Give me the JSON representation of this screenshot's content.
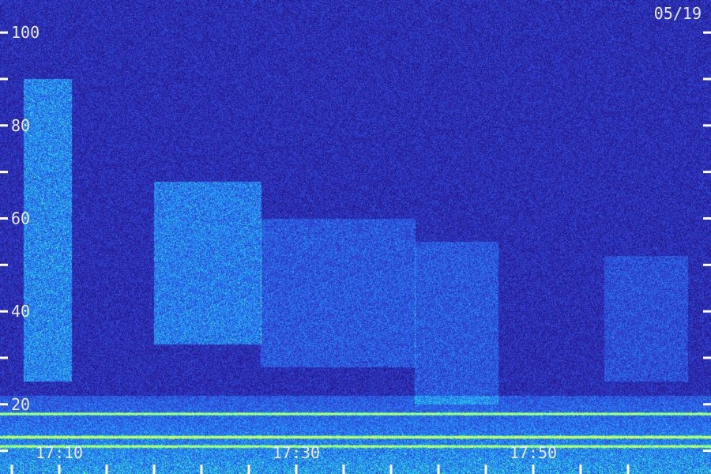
{
  "date_label": "05/19",
  "chart_data": {
    "type": "heatmap",
    "title": "",
    "xlabel": "",
    "ylabel": "",
    "y_ticks": [
      {
        "value": 100,
        "label": "100"
      },
      {
        "value": 90,
        "label": ""
      },
      {
        "value": 80,
        "label": "80"
      },
      {
        "value": 70,
        "label": ""
      },
      {
        "value": 60,
        "label": "60"
      },
      {
        "value": 50,
        "label": ""
      },
      {
        "value": 40,
        "label": "40"
      },
      {
        "value": 30,
        "label": ""
      },
      {
        "value": 20,
        "label": "20"
      },
      {
        "value": 10,
        "label": ""
      }
    ],
    "ylim": [
      5,
      107
    ],
    "x_start": "17:05",
    "x_end": "18:05",
    "x_ticks": [
      {
        "value": "17:06",
        "label": ""
      },
      {
        "value": "17:10",
        "label": "17:10"
      },
      {
        "value": "17:14",
        "label": ""
      },
      {
        "value": "17:18",
        "label": ""
      },
      {
        "value": "17:22",
        "label": ""
      },
      {
        "value": "17:26",
        "label": ""
      },
      {
        "value": "17:30",
        "label": "17:30"
      },
      {
        "value": "17:34",
        "label": ""
      },
      {
        "value": "17:38",
        "label": ""
      },
      {
        "value": "17:42",
        "label": ""
      },
      {
        "value": "17:46",
        "label": ""
      },
      {
        "value": "17:50",
        "label": "17:50"
      },
      {
        "value": "17:54",
        "label": ""
      },
      {
        "value": "17:58",
        "label": ""
      }
    ],
    "colormap": [
      "#140a4a",
      "#2a1fa0",
      "#3050e0",
      "#20a0ff",
      "#40ffb0",
      "#e0ff40"
    ],
    "features": [
      {
        "name": "broadband-burst-1",
        "t_start": "17:07",
        "t_end": "17:11",
        "f_low": 25,
        "f_high": 90,
        "intensity": 0.55
      },
      {
        "name": "harmonic-burst-2",
        "t_start": "17:18",
        "t_end": "17:27",
        "f_low": 33,
        "f_high": 68,
        "intensity": 0.5
      },
      {
        "name": "band-3",
        "t_start": "17:27",
        "t_end": "17:40",
        "f_low": 28,
        "f_high": 60,
        "intensity": 0.3
      },
      {
        "name": "band-4",
        "t_start": "17:40",
        "t_end": "17:47",
        "f_low": 20,
        "f_high": 55,
        "intensity": 0.3
      },
      {
        "name": "band-5",
        "t_start": "17:56",
        "t_end": "18:03",
        "f_low": 25,
        "f_high": 52,
        "intensity": 0.25
      },
      {
        "name": "low-freq-line-1",
        "f": 18,
        "intensity": 0.9
      },
      {
        "name": "low-freq-line-2",
        "f": 13,
        "intensity": 1.0
      },
      {
        "name": "low-freq-line-3",
        "f": 11,
        "intensity": 0.8
      }
    ]
  }
}
